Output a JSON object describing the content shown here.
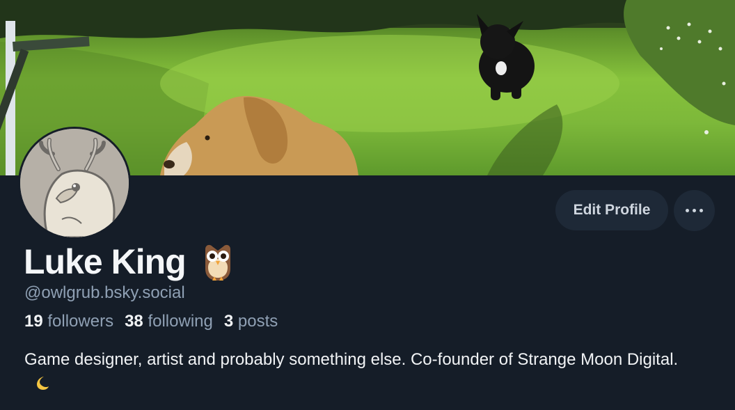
{
  "profile": {
    "display_name": "Luke King",
    "name_emoji": "owl",
    "handle": "@owlgrub.bsky.social",
    "followers_count": "19",
    "followers_label": "followers",
    "following_count": "38",
    "following_label": "following",
    "posts_count": "3",
    "posts_label": "posts",
    "bio": "Game designer, artist and probably something else. Co-founder of Strange Moon Digital.",
    "bio_emoji": "crescent-moon"
  },
  "actions": {
    "edit_label": "Edit Profile",
    "more_icon": "ellipsis-icon"
  },
  "colors": {
    "background": "#151d28",
    "button_bg": "#1e2937",
    "muted_text": "#8fa0b4",
    "primary_text": "#f1f3f5"
  }
}
